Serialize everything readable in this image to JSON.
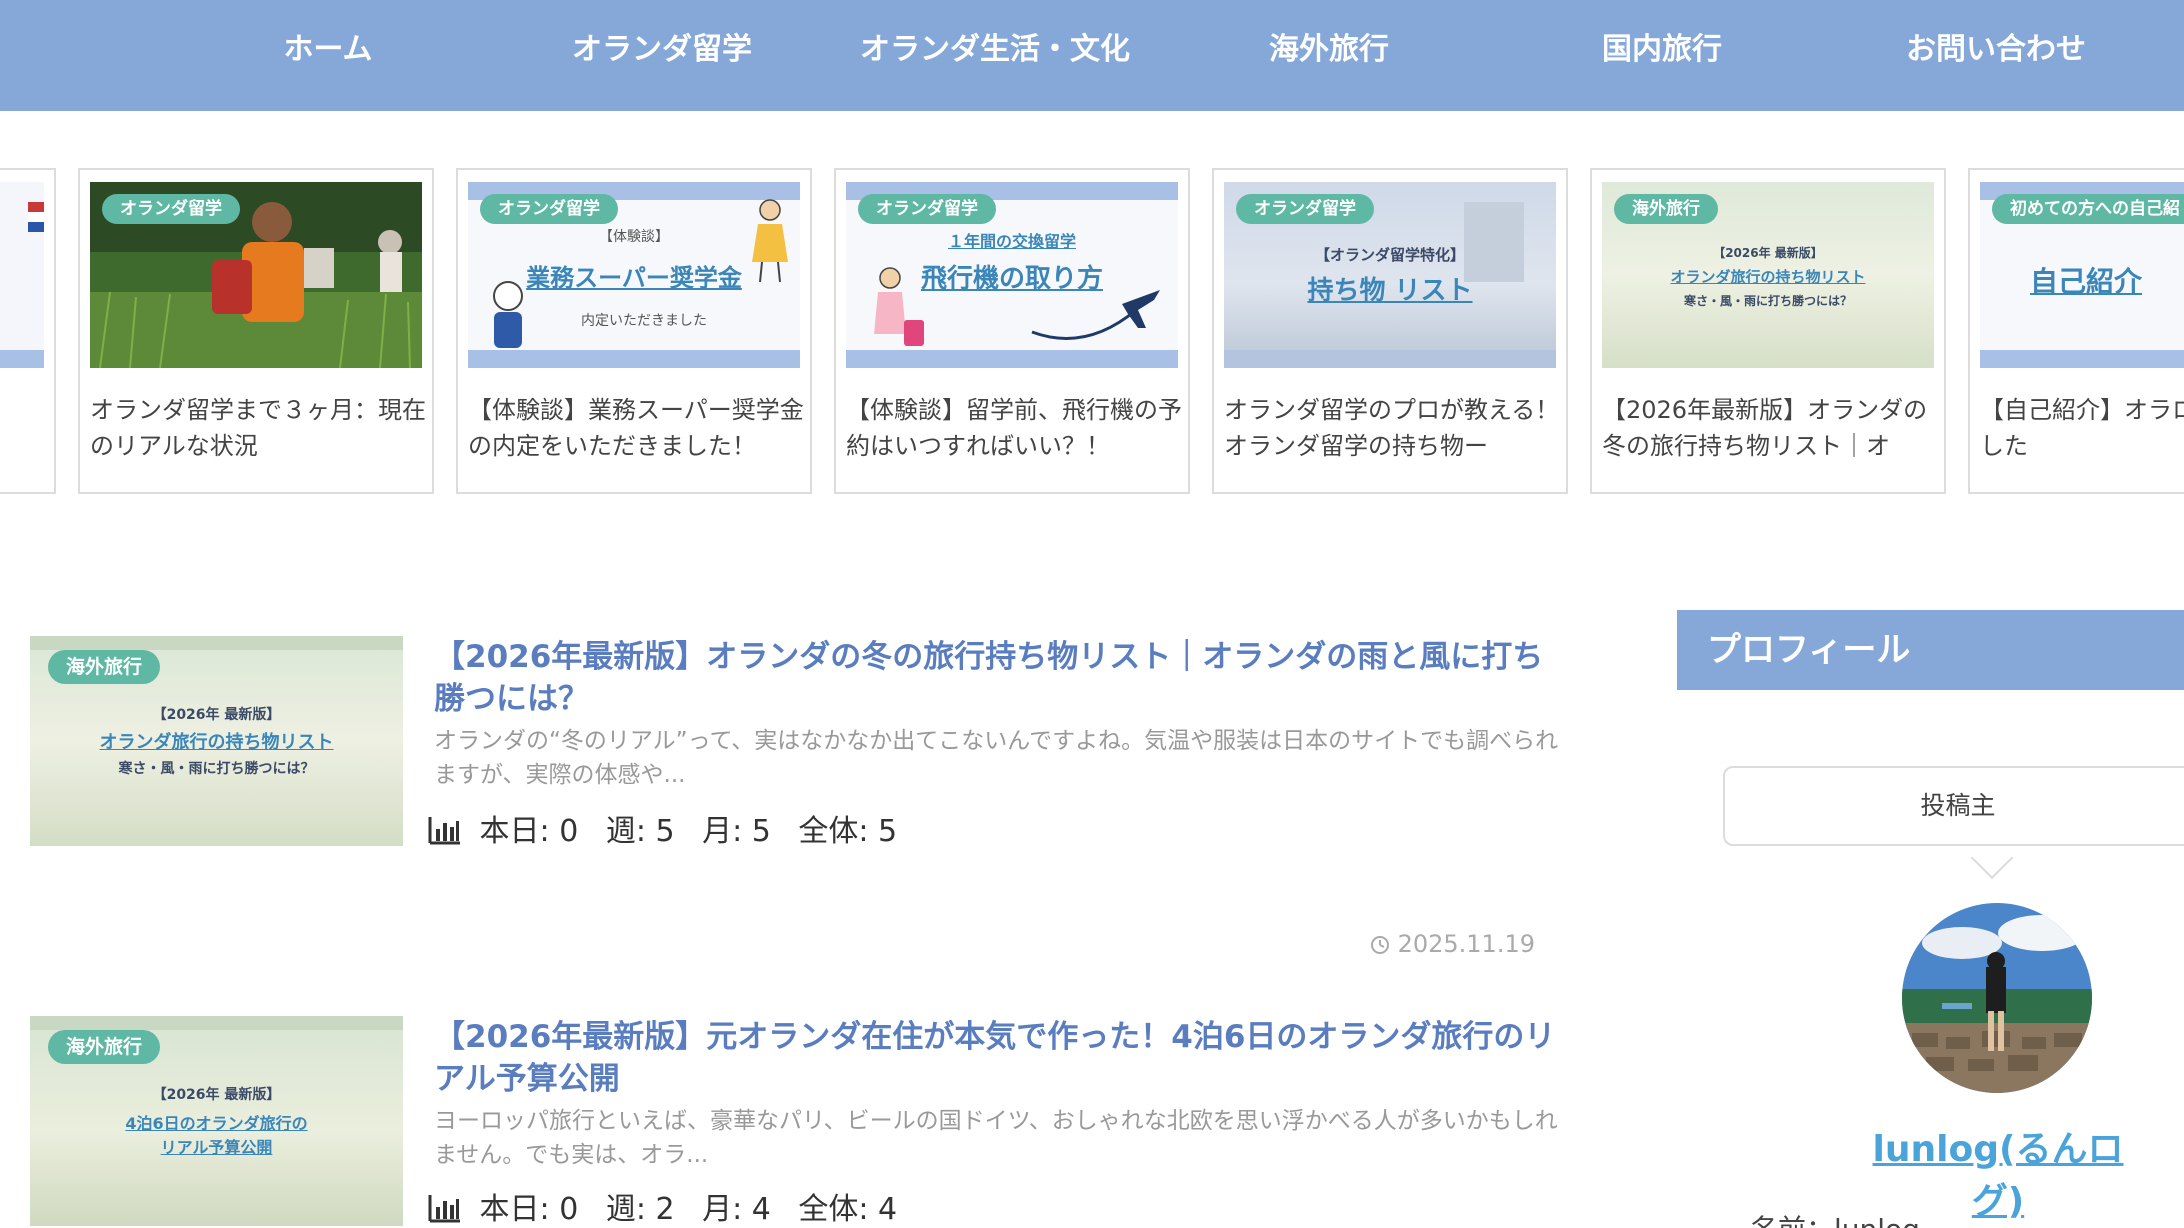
{
  "nav": {
    "items": [
      "ホーム",
      "オランダ留学",
      "オランダ生活・文化",
      "海外旅行",
      "国内旅行",
      "お問い合わせ"
    ]
  },
  "carousel": {
    "cards": [
      {
        "badge": "オランダ留学",
        "title": "オランダ留学まで３ヶ月：現在のリアルな状況",
        "thumb_lines": []
      },
      {
        "badge": "オランダ留学",
        "title": "【体験談】業務スーパー奨学金の内定をいただきました！",
        "thumb_lines": [
          "【体験談】",
          "業務スーパー奨学金",
          "内定いただきました"
        ]
      },
      {
        "badge": "オランダ留学",
        "title": "【体験談】留学前、飛行機の予約はいつすればいい？！",
        "thumb_lines": [
          "１年間の交換留学",
          "飛行機の取り方"
        ]
      },
      {
        "badge": "オランダ留学",
        "title": "オランダ留学のプロが教える！オランダ留学の持ち物ー",
        "thumb_lines": [
          "【オランダ留学特化】",
          "持ち物 リスト"
        ]
      },
      {
        "badge": "海外旅行",
        "title": "【2026年最新版】オランダの冬の旅行持ち物リスト｜オ",
        "thumb_lines": [
          "【2026年 最新版】",
          "オランダ旅行の持ち物リスト",
          "寒さ・風・雨に打ち勝つには？"
        ]
      },
      {
        "badge": "初めての方への自己紹",
        "title": "【自己紹介】オラログ開設しました",
        "thumb_lines": [
          "自己紹介"
        ]
      }
    ]
  },
  "posts": [
    {
      "badge": "海外旅行",
      "thumb_lines": [
        "【2026年 最新版】",
        "オランダ旅行の持ち物リスト",
        "寒さ・風・雨に打ち勝つには？"
      ],
      "title": "【2026年最新版】オランダの冬の旅行持ち物リスト｜オランダの雨と風に打ち勝つには？",
      "excerpt": "オランダの“冬のリアル”って、実はなかなか出てこないんですよね。気温や服装は日本のサイトでも調べられますが、実際の体感や...",
      "stats": {
        "today": "本日: 0",
        "week": "週: 5",
        "month": "月: 5",
        "total": "全体: 5"
      },
      "date": "2025.11.19"
    },
    {
      "badge": "海外旅行",
      "thumb_lines": [
        "【2026年 最新版】",
        "4泊6日のオランダ旅行の",
        "リアル予算公開"
      ],
      "title": "【2026年最新版】元オランダ在住が本気で作った！4泊6日のオランダ旅行のリアル予算公開",
      "excerpt": "ヨーロッパ旅行といえば、豪華なパリ、ビールの国ドイツ、おしゃれな北欧を思い浮かべる人が多いかもしれません。でも実は、オラ...",
      "stats": {
        "today": "本日: 0",
        "week": "週: 2",
        "month": "月: 4",
        "total": "全体: 4"
      }
    }
  ],
  "sidebar": {
    "widget_title": "プロフィール",
    "bubble": "投稿主",
    "profile_name": "lunlog(るんログ)",
    "profile_sub": "名前：lunlog"
  },
  "colors": {
    "nav_bg": "#86a8d9",
    "badge": "#5fb8a4",
    "post_title": "#5a7dbf",
    "profile_link": "#4aa3d9"
  }
}
